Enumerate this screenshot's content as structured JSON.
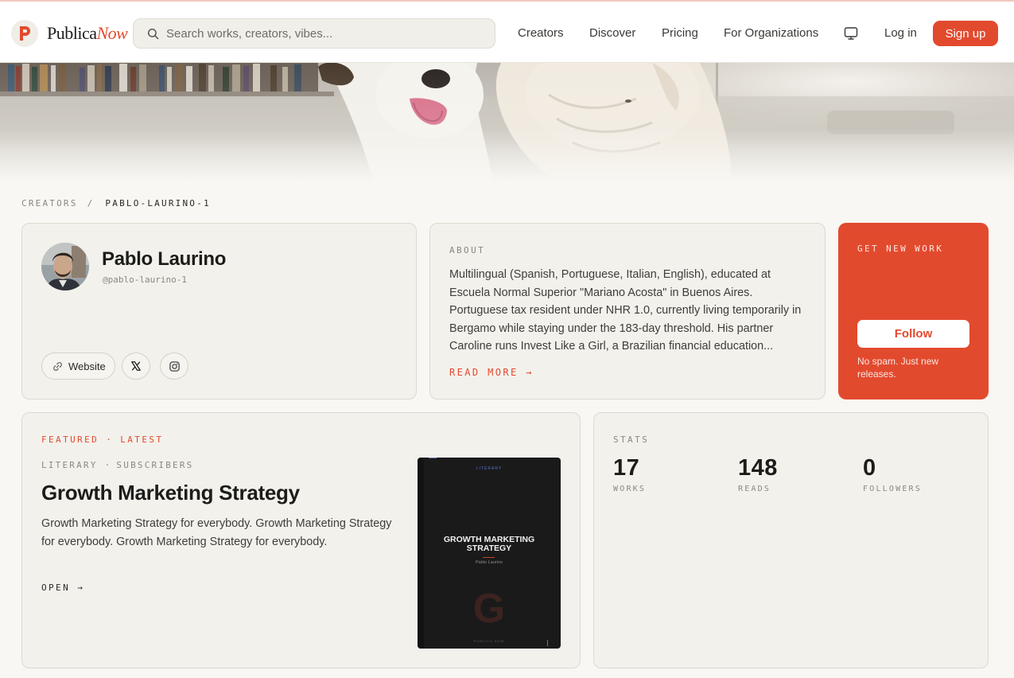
{
  "nav": {
    "brand_prefix": "Publica",
    "brand_suffix": "Now",
    "search_placeholder": "Search works, creators, vibes...",
    "links": [
      "Creators",
      "Discover",
      "Pricing",
      "For Organizations"
    ],
    "login": "Log in",
    "signup": "Sign up"
  },
  "breadcrumb": {
    "root": "CREATORS",
    "separator": "/",
    "current": "PABLO-LAURINO-1"
  },
  "profile": {
    "name": "Pablo Laurino",
    "handle": "@pablo-laurino-1",
    "website_label": "Website",
    "social_icons": [
      "x-icon",
      "instagram-icon"
    ]
  },
  "about": {
    "label": "ABOUT",
    "text": "Multilingual (Spanish, Portuguese, Italian, English), educated at Escuela Normal Superior \"Mariano Acosta\" in Buenos Aires. Portuguese tax resident under NHR 1.0, currently living temporarily in Bergamo while staying under the 183-day threshold. His partner Caroline runs Invest Like a Girl, a Brazilian financial education...",
    "read_more": "READ MORE →"
  },
  "cta": {
    "label": "GET NEW WORK",
    "button": "Follow",
    "note": "No spam. Just new releases."
  },
  "featured": {
    "tag": "FEATURED · LATEST",
    "category": "LITERARY",
    "dot": "·",
    "access": "SUBSCRIBERS",
    "title": "Growth Marketing Strategy",
    "description": "Growth Marketing Strategy for everybody. Growth Marketing Strategy for everybody. Growth Marketing Strategy for everybody.",
    "open": "OPEN →",
    "cover": {
      "category": "LITERARY",
      "title": "GROWTH MARKETING STRATEGY",
      "author": "Pablo Laurino",
      "initial": "G",
      "footer": "PUBLICA NOW"
    }
  },
  "stats": {
    "label": "STATS",
    "items": [
      {
        "value": "17",
        "caption": "WORKS"
      },
      {
        "value": "148",
        "caption": "READS"
      },
      {
        "value": "0",
        "caption": "FOLLOWERS"
      }
    ]
  },
  "colors": {
    "accent": "#e24a2e",
    "background": "#f8f7f3",
    "card": "#f3f1ec"
  }
}
